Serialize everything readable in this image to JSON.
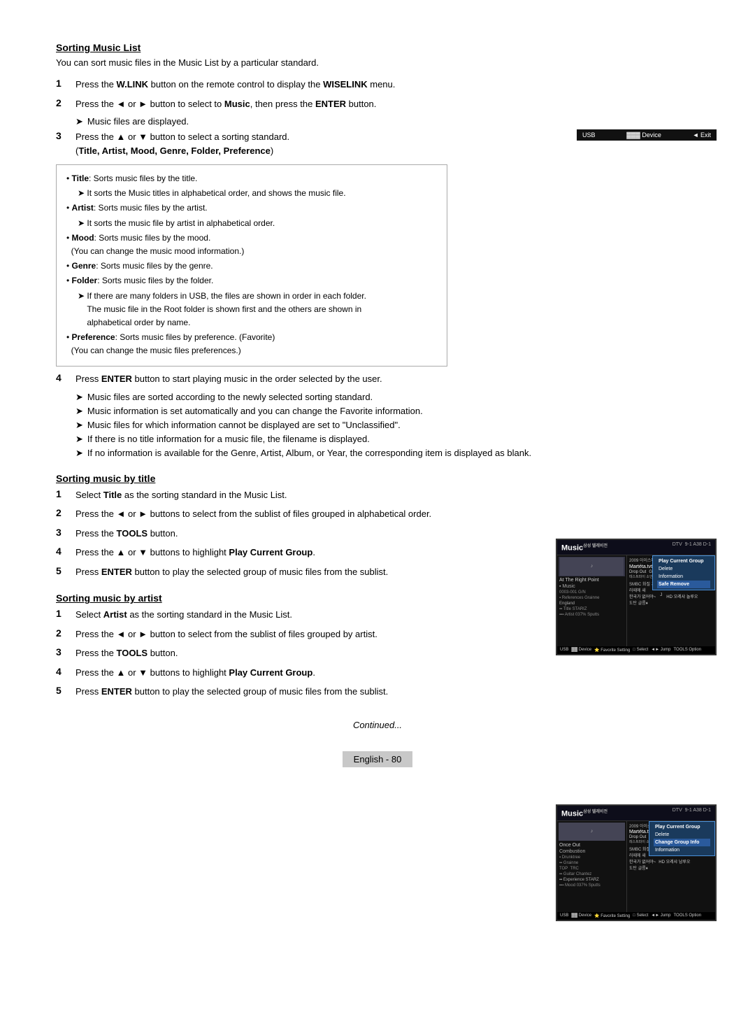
{
  "page": {
    "title": "Sorting Music List",
    "intro": "You can sort music files in the Music List by a particular standard.",
    "steps": [
      {
        "number": "1",
        "text": "Press the W.LINK button on the remote control to display the WISELINK menu.",
        "bold_words": [
          "W.LINK",
          "WISELINK"
        ]
      },
      {
        "number": "2",
        "text": "Press the ◄ or ► button to select to Music, then press the ENTER button.",
        "bold_words": [
          "Music",
          "ENTER"
        ],
        "note": "Music files are displayed."
      },
      {
        "number": "3",
        "text": "Press the ▲ or ▼ button to select a sorting standard. (Title, Artist, Mood, Genre, Folder, Preference)",
        "bold_words": [
          "Title, Artist, Mood, Genre, Folder, Preference"
        ]
      }
    ],
    "bullet_items": [
      {
        "type": "bullet",
        "text": "Title: Sorts music files by the title."
      },
      {
        "type": "arrow",
        "text": "It sorts the Music titles in alphabetical order, and shows the music file."
      },
      {
        "type": "bullet",
        "text": "Artist: Sorts music files by the artist."
      },
      {
        "type": "arrow",
        "text": "It sorts the music file by artist in alphabetical order."
      },
      {
        "type": "bullet",
        "text": "Mood: Sorts music files by the mood. (You can change the music mood information.)"
      },
      {
        "type": "bullet",
        "text": "Genre: Sorts music files by the genre."
      },
      {
        "type": "bullet",
        "text": "Folder: Sorts music files by the folder."
      },
      {
        "type": "arrow",
        "text": "If there are many folders in USB, the files are shown in order in each folder. The music file in the Root folder is shown first and the others are shown in alphabetical order by name."
      },
      {
        "type": "bullet",
        "text": "Preference: Sorts music files by preference. (Favorite) (You can change the music files preferences.)"
      }
    ],
    "step4": {
      "number": "4",
      "text": "Press ENTER button to start playing music in the order selected by the user.",
      "bold_words": [
        "ENTER"
      ],
      "notes": [
        "Music files are sorted according to the newly selected sorting standard.",
        "Music information is set automatically and you can change the Favorite information.",
        "Music files for which information cannot be displayed are set to \"Unclassified\".",
        "If there is no title information for a music file, the filename is displayed.",
        "If no information is available for the Genre, Artist, Album, or Year, the corresponding item is displayed as blank."
      ]
    },
    "subsection1": {
      "title": "Sorting music by title",
      "steps": [
        {
          "number": "1",
          "text": "Select Title as the sorting standard in the Music List.",
          "bold": "Title"
        },
        {
          "number": "2",
          "text": "Press the ◄ or ► buttons to select from the sublist of files grouped in alphabetical order."
        },
        {
          "number": "3",
          "text": "Press the TOOLS button.",
          "bold": "TOOLS"
        },
        {
          "number": "4",
          "text": "Press the ▲ or ▼ buttons to highlight Play Current Group.",
          "bold": "Play Current Group"
        },
        {
          "number": "5",
          "text": "Press ENTER button to play the selected group of music files from the sublist.",
          "bold": "ENTER"
        }
      ]
    },
    "subsection2": {
      "title": "Sorting music by artist",
      "steps": [
        {
          "number": "1",
          "text": "Select Artist as the sorting standard in the Music List.",
          "bold": "Artist"
        },
        {
          "number": "2",
          "text": "Press the ◄ or ► button to select from the sublist of files grouped by artist."
        },
        {
          "number": "3",
          "text": "Press the TOOLS button.",
          "bold": "TOOLS"
        },
        {
          "number": "4",
          "text": "Press the ▲ or ▼ buttons to highlight Play Current Group.",
          "bold": "Play Current Group"
        },
        {
          "number": "5",
          "text": "Press ENTER button to play the selected group of music files from the sublist.",
          "bold": "ENTER"
        }
      ]
    },
    "continued": "Continued...",
    "page_label": "English - 80",
    "usb_bar": "USB  Device  ◄ Exit",
    "tv_logo": "Music",
    "tv_subtitle": "삼성 텔레비전",
    "context_menu_1": {
      "items": [
        "Play Current Group",
        "Delete",
        "Information",
        "Safe Remove"
      ]
    },
    "context_menu_2": {
      "items": [
        "Play Current Group",
        "Delete",
        "Change Group Info",
        "Information"
      ]
    }
  }
}
